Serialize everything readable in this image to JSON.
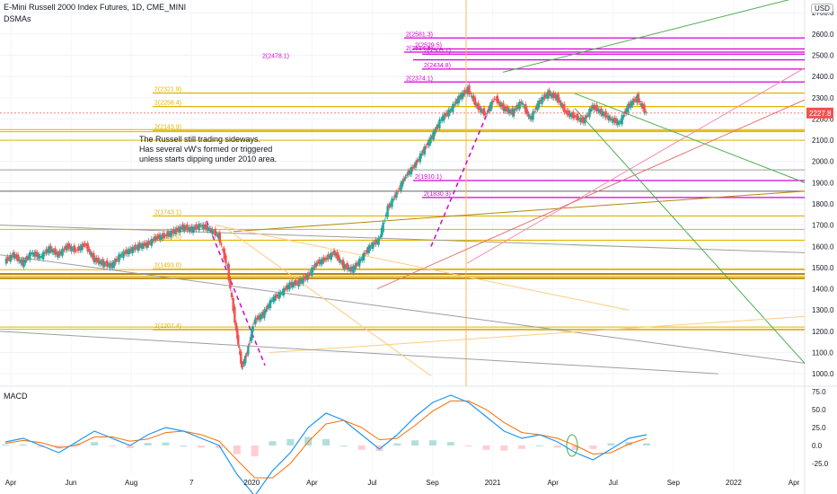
{
  "header": {
    "title": "E-Mini Russell 2000 Index Futures, 1D, CME_MINI",
    "indicator": "DSMAs",
    "currency": "USD",
    "note": "The Russell still trading sideways.\nHas several vW's formed or triggered\nunless starts dipping under 2010 area."
  },
  "colors": {
    "up": "#26a69a",
    "down": "#ef5350",
    "gold": "#e0b400",
    "magenta": "#d400d4",
    "green": "#4caf50",
    "darkgold": "#b8860b",
    "macd": "#2196f3",
    "signal": "#ff6d00"
  },
  "chart_data": [
    {
      "type": "candlestick",
      "title": "E-Mini Russell 2000 Index Futures, 1D, CME_MINI",
      "x_ticks": [
        "Apr",
        "Jun",
        "Aug",
        "7",
        "2020",
        "Apr",
        "Jul",
        "Sep",
        "2021",
        "Apr",
        "Jul",
        "Sep",
        "2022",
        "Apr"
      ],
      "y_ticks": [
        1000,
        1100,
        1200,
        1300,
        1400,
        1500,
        1600,
        1700,
        1800,
        1900,
        2000,
        2100,
        2200,
        2300,
        2400,
        2500,
        2600,
        2700
      ],
      "ylim": [
        950,
        2760
      ],
      "last_price": "2227.8",
      "price_path": [
        [
          0,
          1530
        ],
        [
          0.5,
          1560
        ],
        [
          1,
          1520
        ],
        [
          1.5,
          1570
        ],
        [
          2,
          1550
        ],
        [
          2.5,
          1590
        ],
        [
          3,
          1560
        ],
        [
          3.5,
          1600
        ],
        [
          4,
          1580
        ],
        [
          4.5,
          1610
        ],
        [
          5,
          1540
        ],
        [
          5.5,
          1520
        ],
        [
          6,
          1510
        ],
        [
          6.5,
          1560
        ],
        [
          7,
          1580
        ],
        [
          7.5,
          1600
        ],
        [
          8,
          1610
        ],
        [
          8.5,
          1640
        ],
        [
          9,
          1650
        ],
        [
          9.5,
          1670
        ],
        [
          10,
          1690
        ],
        [
          10.5,
          1680
        ],
        [
          11,
          1700
        ],
        [
          11.5,
          1680
        ],
        [
          12,
          1650
        ],
        [
          12.5,
          1500
        ],
        [
          13,
          1200
        ],
        [
          13.3,
          1030
        ],
        [
          13.6,
          1100
        ],
        [
          14,
          1250
        ],
        [
          14.5,
          1280
        ],
        [
          15,
          1350
        ],
        [
          15.5,
          1380
        ],
        [
          16,
          1420
        ],
        [
          16.5,
          1430
        ],
        [
          17,
          1460
        ],
        [
          17.5,
          1520
        ],
        [
          18,
          1540
        ],
        [
          18.5,
          1570
        ],
        [
          19,
          1510
        ],
        [
          19.5,
          1490
        ],
        [
          20,
          1540
        ],
        [
          20.5,
          1600
        ],
        [
          21,
          1630
        ],
        [
          21.5,
          1780
        ],
        [
          22,
          1850
        ],
        [
          22.5,
          1930
        ],
        [
          23,
          1980
        ],
        [
          23.5,
          2050
        ],
        [
          24,
          2120
        ],
        [
          24.5,
          2200
        ],
        [
          25,
          2240
        ],
        [
          25.5,
          2300
        ],
        [
          26,
          2340
        ],
        [
          26.5,
          2260
        ],
        [
          27,
          2220
        ],
        [
          27.5,
          2300
        ],
        [
          28,
          2250
        ],
        [
          28.5,
          2230
        ],
        [
          29,
          2280
        ],
        [
          29.5,
          2200
        ],
        [
          30,
          2280
        ],
        [
          30.5,
          2320
        ],
        [
          31,
          2300
        ],
        [
          31.5,
          2230
        ],
        [
          32,
          2210
        ],
        [
          32.5,
          2190
        ],
        [
          33,
          2260
        ],
        [
          33.5,
          2230
        ],
        [
          34,
          2200
        ],
        [
          34.5,
          2180
        ],
        [
          35,
          2260
        ],
        [
          35.5,
          2300
        ],
        [
          36,
          2227.8
        ]
      ],
      "horizontal_levels": [
        {
          "price": 2581.3,
          "label": "2(2581.3)",
          "color": "magenta"
        },
        {
          "price": 2529.5,
          "label": "2(2529.5)",
          "color": "magenta"
        },
        {
          "price": 2505.1,
          "label": "2(2505.1)",
          "color": "magenta"
        },
        {
          "price": 2514.6,
          "label": "2(2514.6)",
          "color": "magenta"
        },
        {
          "price": 2478.1,
          "label": "2(2478.1)",
          "color": "magenta"
        },
        {
          "price": 2434.8,
          "label": "2(2434.8)",
          "color": "magenta"
        },
        {
          "price": 2374.1,
          "label": "2(2374.1)",
          "color": "magenta"
        },
        {
          "price": 2321.9,
          "label": "2(2321.9)",
          "color": "gold"
        },
        {
          "price": 2258.4,
          "label": "2(2258.4)",
          "color": "gold"
        },
        {
          "price": 2143.9,
          "label": "2(2143.9)",
          "color": "gold"
        },
        {
          "price": 1910.1,
          "label": "2(1910.1)",
          "color": "magenta"
        },
        {
          "price": 1830.3,
          "label": "2(1830.3)",
          "color": "magenta"
        },
        {
          "price": 1743.1,
          "label": "2(1743.1)",
          "color": "gold"
        },
        {
          "price": 1629.0,
          "label": "2(1629.0)",
          "color": "gold"
        },
        {
          "price": 1493.0,
          "label": "2(1493.0)",
          "color": "gold"
        },
        {
          "price": 1207.4,
          "label": "2(1207.4)",
          "color": "gold"
        }
      ],
      "level_labels_misc": [
        "2(2286.0)",
        "2(2323)",
        "2(2191.5)",
        "2(2099.6)",
        "2(1955.0)",
        "2(1870.1)",
        "2(1526.0)",
        "2(1418.6)",
        "2(1232.8)",
        "2(1308.0)",
        "2(1349.8)",
        "2(1380.8)",
        "2(1396.0)",
        "2(1640.0)"
      ],
      "annotation": "The Russell still trading sideways. Has several vW's formed or triggered unless starts dipping under 2010 area."
    },
    {
      "type": "line",
      "title": "MACD",
      "y_ticks": [
        75.0,
        50.0,
        25.0,
        0.0,
        -25.0
      ],
      "ylim": [
        -40,
        80
      ],
      "series": [
        {
          "name": "MACD",
          "values": [
            5,
            10,
            0,
            -10,
            5,
            20,
            10,
            0,
            15,
            25,
            20,
            10,
            0,
            -40,
            -70,
            -35,
            -10,
            25,
            45,
            35,
            15,
            -5,
            15,
            40,
            60,
            70,
            60,
            40,
            20,
            10,
            15,
            5,
            -10,
            -20,
            -5,
            10,
            15
          ]
        },
        {
          "name": "Signal",
          "values": [
            3,
            7,
            4,
            -3,
            0,
            12,
            12,
            6,
            9,
            18,
            20,
            15,
            6,
            -20,
            -45,
            -45,
            -25,
            5,
            30,
            35,
            25,
            8,
            10,
            28,
            48,
            62,
            62,
            50,
            32,
            18,
            15,
            10,
            0,
            -12,
            -10,
            2,
            10
          ]
        }
      ]
    }
  ]
}
